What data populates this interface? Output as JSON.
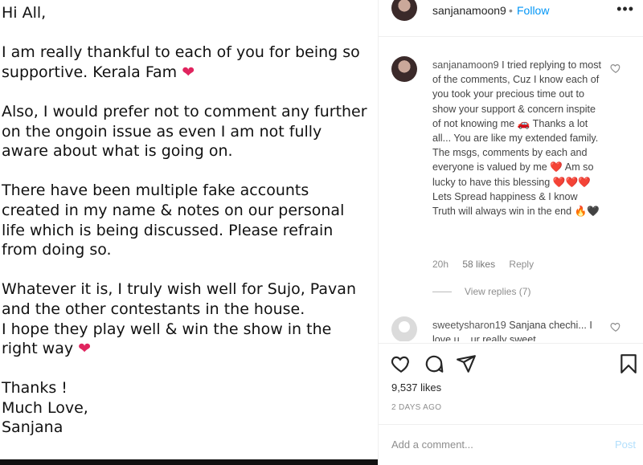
{
  "note": {
    "greeting": "Hi All,",
    "para1": "I am really thankful to each of you for being so supportive. Kerala Fam",
    "para2": "Also, I would prefer not to comment any further on the ongoin issue as even I am not fully aware about what is going on.",
    "para3": "There have been multiple fake accounts created in my name & notes on our personal life which is being discussed. Please refrain from doing so.",
    "para4a": "Whatever it is, I truly wish well for Sujo, Pavan and the other contestants in the house.",
    "para4b": "I hope they play well & win the show in the right way",
    "signoff1": "Thanks !",
    "signoff2": "Much Love,",
    "signoff3": "Sanjana",
    "heart": "❤"
  },
  "header": {
    "username": "sanjanamoon9",
    "separator": "•",
    "follow_label": "Follow",
    "more_label": "•••"
  },
  "comments": [
    {
      "username": "sanjanamoon9",
      "text": "I tried replying to most of the comments, Cuz I know each of you took your precious time out to show your support & concern inspite of not knowing me 🚗 Thanks a lot all... You are like my extended family. The msgs, comments by each and everyone is valued by me ❤️ Am so lucky to have this blessing ❤️❤️❤️ Lets Spread happiness & I know Truth will always win in the end 🔥🖤",
      "time": "20h",
      "likes": "58 likes",
      "reply_label": "Reply",
      "view_replies": "View replies (7)"
    },
    {
      "username": "sweetysharon19",
      "text": "Sanjana chechi... I love u... ur really sweet"
    }
  ],
  "actions": {
    "likes": "9,537 likes",
    "date": "2 DAYS AGO"
  },
  "add_comment": {
    "placeholder": "Add a comment...",
    "post_label": "Post"
  },
  "colors": {
    "follow": "#0095f6",
    "heart": "#e0245e",
    "post_disabled": "#b2dffc"
  }
}
